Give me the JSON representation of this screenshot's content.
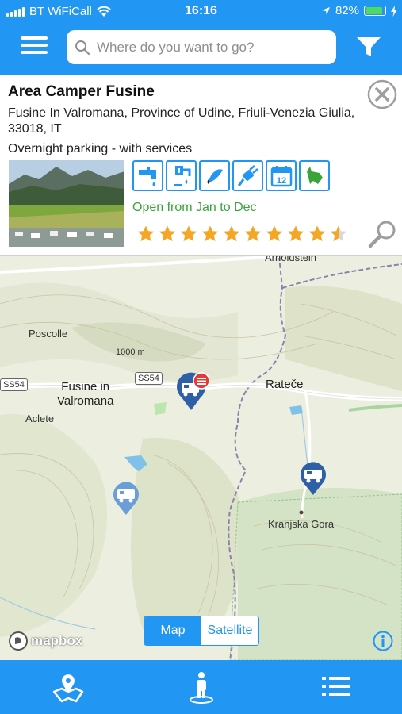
{
  "status_bar": {
    "carrier": "BT WiFiCall",
    "time": "16:16",
    "battery": "82%",
    "battery_level": 0.82
  },
  "header": {
    "search_placeholder": "Where do you want to go?",
    "icons": [
      "menu-icon",
      "search-icon",
      "filter-icon"
    ]
  },
  "card": {
    "title": "Area Camper Fusine",
    "address": "Fusine In Valromana, Province of Udine, Friuli-Venezia Giulia, 33018, IT",
    "parking_type": "Overnight parking - with services",
    "opening": "Open from Jan to Dec",
    "rating": 9.5,
    "rating_max": 10,
    "services": [
      "water-tap-icon",
      "drain-icon",
      "water-dump-icon",
      "electricity-icon",
      "calendar-icon",
      "pets-allowed-icon"
    ],
    "calendar_day": "12",
    "colors": {
      "accent": "#2196f3",
      "open_text": "#3aa43a",
      "star": "#f5a623"
    }
  },
  "map": {
    "labels": {
      "arnoldstein": "Arnoldstein",
      "poscolle": "Poscolle",
      "elevation": "1000 m",
      "road_ss54_a": "SS54",
      "road_ss54_b": "SS54",
      "fusine": "Fusine in\nValromana",
      "aclete": "Aclete",
      "ratece": "Rateče",
      "kranjska": "Kranjska Gora"
    },
    "toggle": {
      "map": "Map",
      "satellite": "Satellite",
      "selected": "Map"
    },
    "attribution": "mapbox"
  },
  "bottom_nav": {
    "items": [
      "map-pin-icon",
      "user-location-icon",
      "list-icon"
    ]
  }
}
